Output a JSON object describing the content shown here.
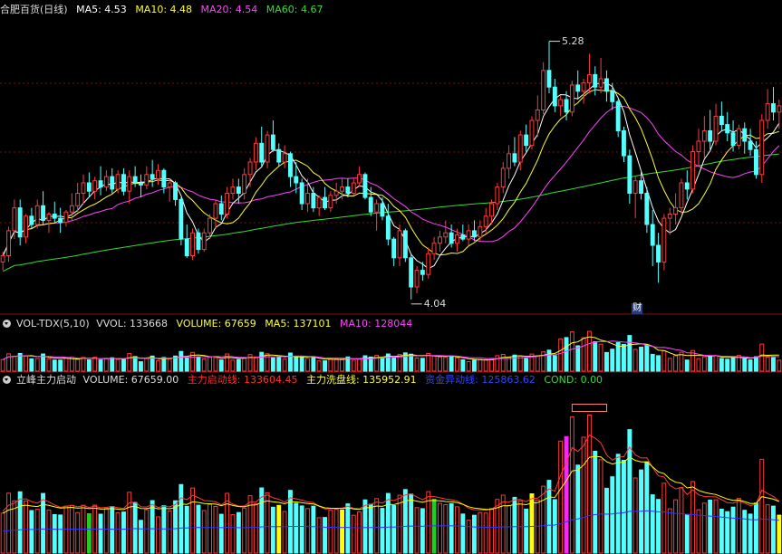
{
  "colors": {
    "up": "#ff3a3a",
    "down": "#54ffff",
    "ma5": "#ffffff",
    "ma10": "#ffff33",
    "ma20": "#ff44ff",
    "ma60": "#33dd33",
    "bg": "#000000",
    "grid": "#7a1010",
    "green": "#22cc22",
    "yellow": "#ffff00",
    "magenta": "#ff22ff",
    "blue": "#3333ff"
  },
  "price_header": {
    "title": "合肥百货(日线)",
    "ma5": "MA5: 4.53",
    "ma10": "MA10: 4.48",
    "ma20": "MA20: 4.54",
    "ma60": "MA60: 4.67"
  },
  "vol_header": {
    "title": "VOL-TDX(5,10)",
    "vvol": "VVOL: 133668",
    "volume": "VOLUME: 67659",
    "ma5": "MA5: 137101",
    "ma10": "MA10: 128044"
  },
  "ind_header": {
    "title": "立峰主力启动",
    "volume": "VOLUME: 67659.00",
    "start": "主力启动线: 133604.45",
    "wash": "主力洗盘线: 135952.91",
    "fund": "资金异动线: 125863.62",
    "cond": "COND: 0.00"
  },
  "annotations": {
    "high": "5.28",
    "low": "4.04",
    "marker": "财"
  },
  "chart_data": {
    "type": "candlestick",
    "ohlc": [
      [
        4.22,
        4.27,
        4.18,
        4.25
      ],
      [
        4.25,
        4.39,
        4.22,
        4.37
      ],
      [
        4.37,
        4.52,
        4.33,
        4.48
      ],
      [
        4.48,
        4.52,
        4.3,
        4.34
      ],
      [
        4.34,
        4.45,
        4.31,
        4.44
      ],
      [
        4.44,
        4.48,
        4.38,
        4.4
      ],
      [
        4.4,
        4.52,
        4.38,
        4.49
      ],
      [
        4.49,
        4.56,
        4.4,
        4.42
      ],
      [
        4.42,
        4.46,
        4.36,
        4.45
      ],
      [
        4.45,
        4.51,
        4.41,
        4.43
      ],
      [
        4.43,
        4.48,
        4.36,
        4.41
      ],
      [
        4.41,
        4.47,
        4.39,
        4.46
      ],
      [
        4.46,
        4.55,
        4.42,
        4.49
      ],
      [
        4.49,
        4.6,
        4.46,
        4.55
      ],
      [
        4.55,
        4.64,
        4.5,
        4.6
      ],
      [
        4.6,
        4.65,
        4.53,
        4.56
      ],
      [
        4.56,
        4.63,
        4.52,
        4.61
      ],
      [
        4.61,
        4.68,
        4.54,
        4.58
      ],
      [
        4.58,
        4.66,
        4.56,
        4.63
      ],
      [
        4.63,
        4.67,
        4.55,
        4.57
      ],
      [
        4.57,
        4.66,
        4.55,
        4.64
      ],
      [
        4.64,
        4.67,
        4.54,
        4.56
      ],
      [
        4.56,
        4.66,
        4.5,
        4.63
      ],
      [
        4.63,
        4.68,
        4.58,
        4.6
      ],
      [
        4.6,
        4.64,
        4.53,
        4.59
      ],
      [
        4.59,
        4.68,
        4.57,
        4.64
      ],
      [
        4.64,
        4.71,
        4.58,
        4.62
      ],
      [
        4.62,
        4.69,
        4.59,
        4.66
      ],
      [
        4.66,
        4.67,
        4.55,
        4.58
      ],
      [
        4.58,
        4.62,
        4.51,
        4.6
      ],
      [
        4.6,
        4.61,
        4.49,
        4.52
      ],
      [
        4.52,
        4.53,
        4.3,
        4.33
      ],
      [
        4.33,
        4.4,
        4.24,
        4.25
      ],
      [
        4.25,
        4.38,
        4.23,
        4.36
      ],
      [
        4.36,
        4.38,
        4.26,
        4.28
      ],
      [
        4.28,
        4.38,
        4.27,
        4.36
      ],
      [
        4.36,
        4.45,
        4.33,
        4.43
      ],
      [
        4.43,
        4.52,
        4.38,
        4.5
      ],
      [
        4.5,
        4.54,
        4.42,
        4.45
      ],
      [
        4.45,
        4.58,
        4.43,
        4.55
      ],
      [
        4.55,
        4.62,
        4.52,
        4.58
      ],
      [
        4.58,
        4.62,
        4.5,
        4.55
      ],
      [
        4.55,
        4.67,
        4.52,
        4.64
      ],
      [
        4.64,
        4.72,
        4.58,
        4.7
      ],
      [
        4.7,
        4.82,
        4.66,
        4.79
      ],
      [
        4.79,
        4.87,
        4.68,
        4.7
      ],
      [
        4.7,
        4.85,
        4.67,
        4.83
      ],
      [
        4.83,
        4.9,
        4.75,
        4.76
      ],
      [
        4.76,
        4.79,
        4.68,
        4.7
      ],
      [
        4.7,
        4.78,
        4.67,
        4.74
      ],
      [
        4.74,
        4.75,
        4.58,
        4.63
      ],
      [
        4.63,
        4.7,
        4.55,
        4.6
      ],
      [
        4.6,
        4.62,
        4.47,
        4.5
      ],
      [
        4.5,
        4.62,
        4.46,
        4.55
      ],
      [
        4.55,
        4.58,
        4.46,
        4.48
      ],
      [
        4.48,
        4.54,
        4.44,
        4.53
      ],
      [
        4.53,
        4.58,
        4.47,
        4.48
      ],
      [
        4.48,
        4.56,
        4.46,
        4.54
      ],
      [
        4.54,
        4.6,
        4.5,
        4.56
      ],
      [
        4.56,
        4.62,
        4.52,
        4.58
      ],
      [
        4.58,
        4.62,
        4.53,
        4.55
      ],
      [
        4.55,
        4.62,
        4.54,
        4.6
      ],
      [
        4.6,
        4.68,
        4.58,
        4.64
      ],
      [
        4.64,
        4.65,
        4.52,
        4.53
      ],
      [
        4.53,
        4.58,
        4.44,
        4.46
      ],
      [
        4.46,
        4.52,
        4.37,
        4.5
      ],
      [
        4.5,
        4.53,
        4.42,
        4.44
      ],
      [
        4.44,
        4.5,
        4.3,
        4.33
      ],
      [
        4.33,
        4.34,
        4.2,
        4.24
      ],
      [
        4.24,
        4.4,
        4.2,
        4.37
      ],
      [
        4.37,
        4.38,
        4.22,
        4.24
      ],
      [
        4.24,
        4.26,
        4.04,
        4.1
      ],
      [
        4.1,
        4.2,
        4.07,
        4.18
      ],
      [
        4.18,
        4.22,
        4.13,
        4.16
      ],
      [
        4.16,
        4.29,
        4.14,
        4.26
      ],
      [
        4.26,
        4.34,
        4.23,
        4.31
      ],
      [
        4.31,
        4.37,
        4.27,
        4.34
      ],
      [
        4.34,
        4.42,
        4.31,
        4.36
      ],
      [
        4.36,
        4.4,
        4.29,
        4.31
      ],
      [
        4.31,
        4.38,
        4.27,
        4.35
      ],
      [
        4.35,
        4.4,
        4.32,
        4.33
      ],
      [
        4.33,
        4.4,
        4.3,
        4.37
      ],
      [
        4.37,
        4.42,
        4.32,
        4.34
      ],
      [
        4.34,
        4.42,
        4.32,
        4.39
      ],
      [
        4.39,
        4.48,
        4.36,
        4.44
      ],
      [
        4.44,
        4.52,
        4.4,
        4.5
      ],
      [
        4.5,
        4.6,
        4.47,
        4.58
      ],
      [
        4.58,
        4.7,
        4.55,
        4.67
      ],
      [
        4.67,
        4.78,
        4.62,
        4.74
      ],
      [
        4.74,
        4.82,
        4.68,
        4.7
      ],
      [
        4.7,
        4.85,
        4.66,
        4.83
      ],
      [
        4.83,
        4.88,
        4.75,
        4.78
      ],
      [
        4.78,
        4.92,
        4.76,
        4.9
      ],
      [
        4.9,
        5.02,
        4.82,
        4.95
      ],
      [
        4.95,
        5.18,
        4.93,
        5.14
      ],
      [
        5.14,
        5.28,
        5.03,
        5.06
      ],
      [
        5.06,
        5.1,
        4.94,
        4.97
      ],
      [
        4.97,
        5.02,
        4.92,
        5.0
      ],
      [
        5.0,
        5.04,
        4.9,
        4.94
      ],
      [
        4.94,
        5.09,
        4.92,
        5.07
      ],
      [
        5.07,
        5.14,
        5.0,
        5.04
      ],
      [
        5.04,
        5.1,
        4.98,
        5.08
      ],
      [
        5.08,
        5.22,
        5.03,
        5.12
      ],
      [
        5.12,
        5.16,
        5.02,
        5.06
      ],
      [
        5.06,
        5.2,
        5.03,
        5.1
      ],
      [
        5.1,
        5.14,
        4.99,
        5.04
      ],
      [
        5.04,
        5.08,
        4.95,
        4.99
      ],
      [
        4.99,
        5.0,
        4.82,
        4.85
      ],
      [
        4.85,
        4.87,
        4.7,
        4.73
      ],
      [
        4.73,
        4.76,
        4.5,
        4.55
      ],
      [
        4.55,
        4.63,
        4.43,
        4.61
      ],
      [
        4.61,
        4.66,
        4.52,
        4.55
      ],
      [
        4.55,
        4.58,
        4.36,
        4.4
      ],
      [
        4.4,
        4.47,
        4.2,
        4.3
      ],
      [
        4.3,
        4.36,
        4.12,
        4.22
      ],
      [
        4.22,
        4.45,
        4.18,
        4.43
      ],
      [
        4.43,
        4.48,
        4.35,
        4.45
      ],
      [
        4.45,
        4.55,
        4.4,
        4.48
      ],
      [
        4.48,
        4.62,
        4.45,
        4.6
      ],
      [
        4.6,
        4.66,
        4.52,
        4.57
      ],
      [
        4.57,
        4.78,
        4.55,
        4.75
      ],
      [
        4.75,
        4.86,
        4.68,
        4.8
      ],
      [
        4.8,
        4.92,
        4.72,
        4.85
      ],
      [
        4.85,
        4.95,
        4.76,
        4.8
      ],
      [
        4.8,
        4.98,
        4.78,
        4.92
      ],
      [
        4.92,
        4.99,
        4.85,
        4.88
      ],
      [
        4.88,
        4.94,
        4.8,
        4.84
      ],
      [
        4.84,
        4.9,
        4.75,
        4.78
      ],
      [
        4.78,
        4.88,
        4.76,
        4.86
      ],
      [
        4.86,
        4.89,
        4.74,
        4.8
      ],
      [
        4.8,
        4.86,
        4.73,
        4.76
      ],
      [
        4.76,
        4.8,
        4.62,
        4.64
      ],
      [
        4.64,
        4.93,
        4.6,
        4.9
      ],
      [
        4.9,
        5.05,
        4.86,
        4.98
      ],
      [
        4.98,
        5.06,
        4.9,
        4.94
      ],
      [
        4.94,
        5.0,
        4.86,
        4.97
      ]
    ],
    "ma_lines": {
      "names": [
        "MA5",
        "MA10",
        "MA20",
        "MA60"
      ],
      "last": [
        4.53,
        4.48,
        4.54,
        4.67
      ]
    },
    "ylim": [
      4.0,
      5.4
    ]
  }
}
